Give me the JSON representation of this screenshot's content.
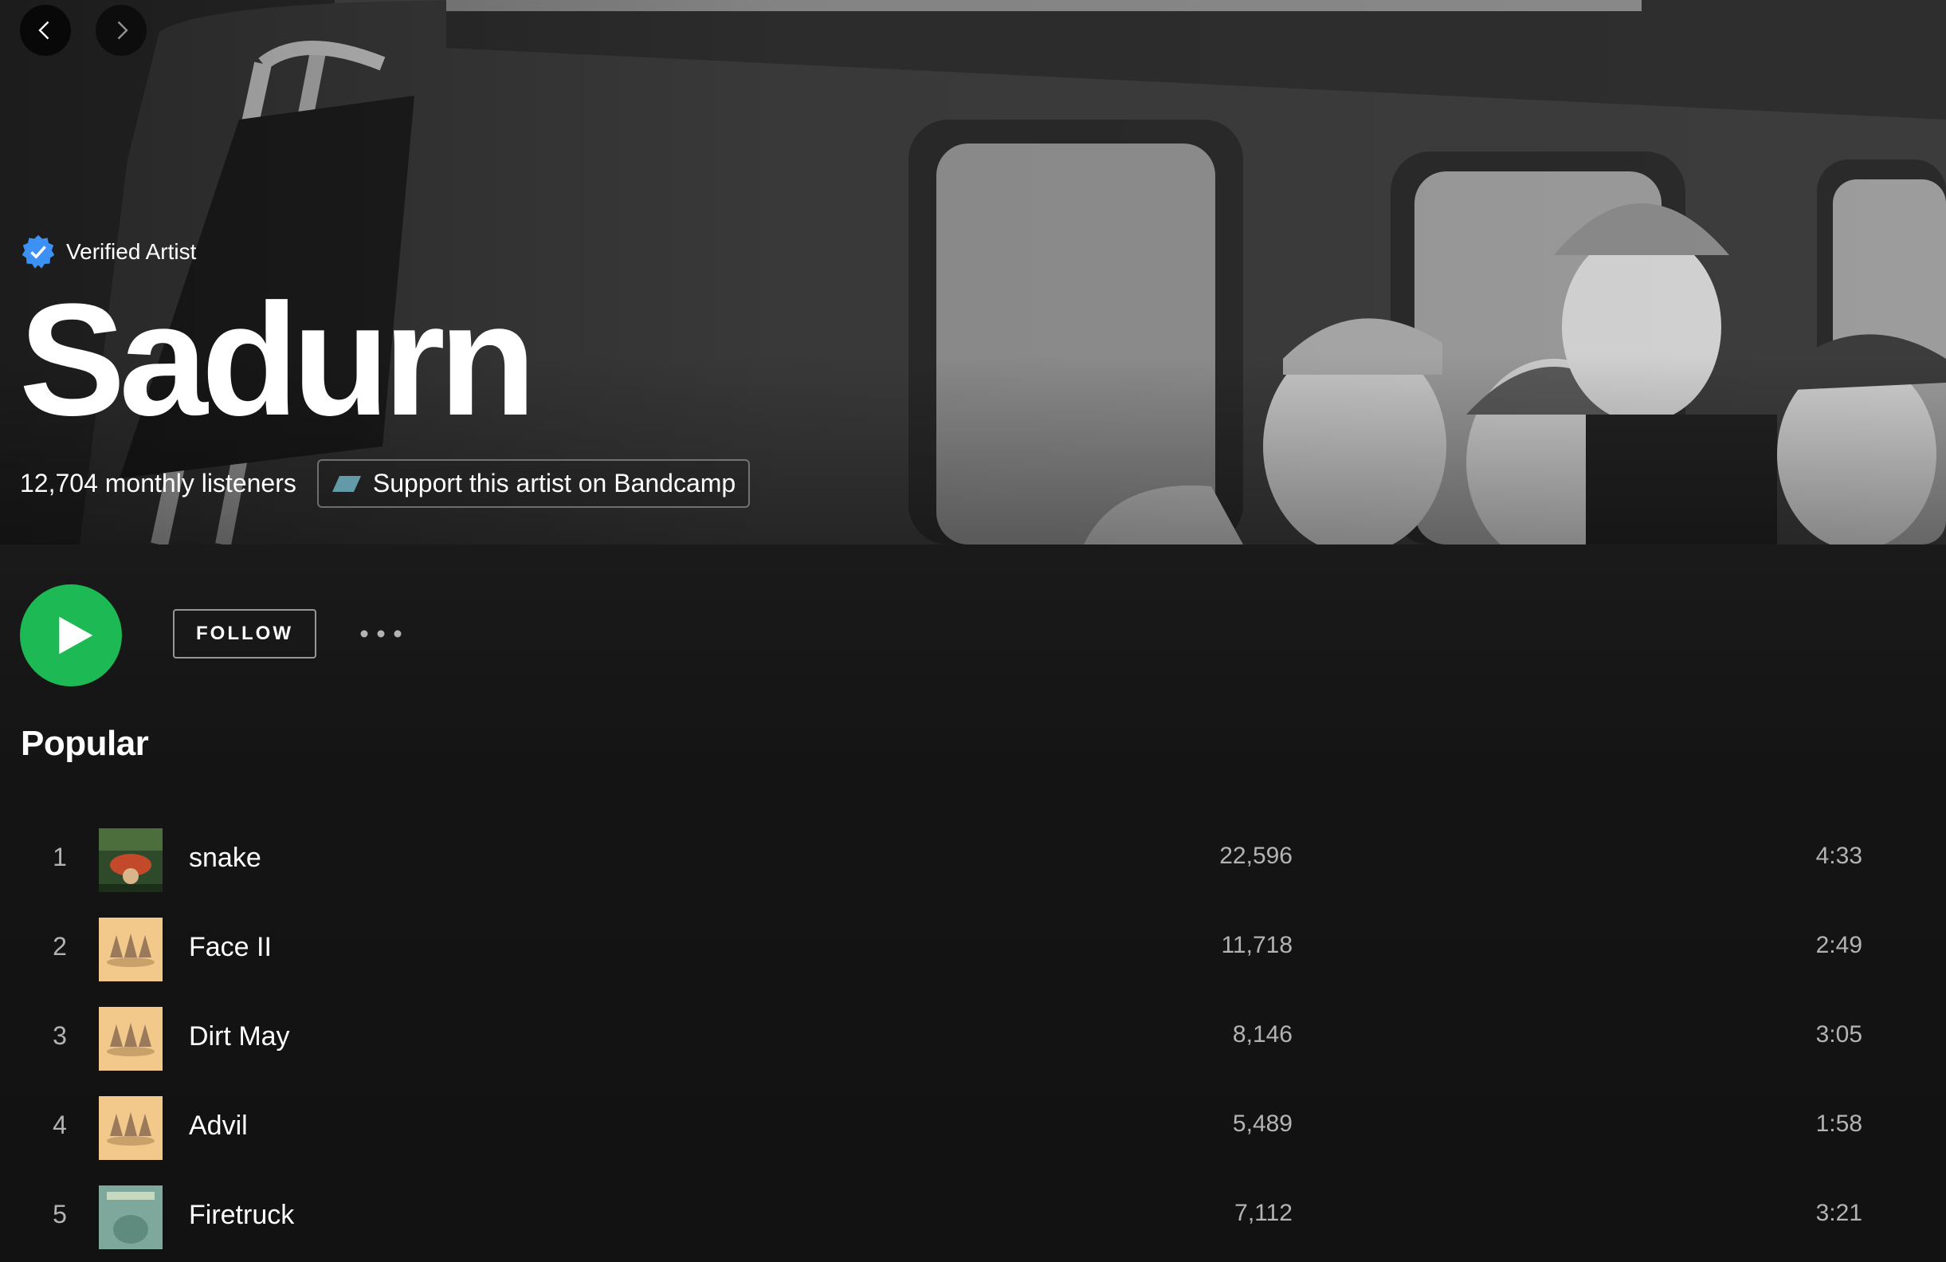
{
  "hero": {
    "verified_label": "Verified Artist",
    "artist_name": "Sadurn",
    "monthly_listeners": "12,704 monthly listeners",
    "bandcamp_label": "Support this artist on Bandcamp"
  },
  "actions": {
    "follow_label": "FOLLOW"
  },
  "popular": {
    "title": "Popular",
    "tracks": [
      {
        "num": "1",
        "title": "snake",
        "plays": "22,596",
        "duration": "4:33",
        "art": "green-album-art"
      },
      {
        "num": "2",
        "title": "Face II",
        "plays": "11,718",
        "duration": "2:49",
        "art": "gnome-album-art"
      },
      {
        "num": "3",
        "title": "Dirt May",
        "plays": "8,146",
        "duration": "3:05",
        "art": "gnome-album-art"
      },
      {
        "num": "4",
        "title": "Advil",
        "plays": "5,489",
        "duration": "1:58",
        "art": "gnome-album-art"
      },
      {
        "num": "5",
        "title": "Firetruck",
        "plays": "7,112",
        "duration": "3:21",
        "art": "teal-album-art"
      }
    ]
  },
  "colors": {
    "accent": "#1db954",
    "background": "#121212",
    "verified_badge": "#3d91f4",
    "secondary_text": "#b3b3b3"
  },
  "icons": [
    "chevron-left-icon",
    "chevron-right-icon",
    "verified-badge-icon",
    "bandcamp-icon",
    "play-icon",
    "more-options-icon"
  ]
}
